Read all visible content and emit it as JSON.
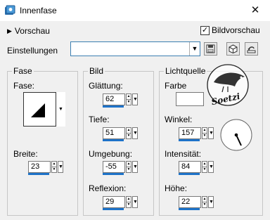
{
  "window": {
    "title": "Innenfase",
    "close_glyph": "✕"
  },
  "preview": {
    "toggle_label": "Vorschau",
    "bildvorschau_label": "Bildvorschau",
    "bildvorschau_checked": true
  },
  "settings": {
    "label": "Einstellungen",
    "value": ""
  },
  "fase_group": {
    "title": "Fase",
    "fase_label": "Fase:",
    "breite_label": "Breite:",
    "breite_value": "23"
  },
  "bild_group": {
    "title": "Bild",
    "glaettung_label": "Glättung:",
    "glaettung_value": "62",
    "tiefe_label": "Tiefe:",
    "tiefe_value": "51",
    "umgebung_label": "Umgebung:",
    "umgebung_value": "-55",
    "reflexion_label": "Reflexion:",
    "reflexion_value": "29"
  },
  "licht_group": {
    "title": "Lichtquelle",
    "farbe_label": "Farbe",
    "winkel_label": "Winkel:",
    "winkel_value": "157",
    "intensitaet_label": "Intensität:",
    "intensitaet_value": "84",
    "hoehe_label": "Höhe:",
    "hoehe_value": "22"
  },
  "watermark": {
    "text": "Soetzi"
  },
  "colors": {
    "accent": "#1e73c9",
    "title_bg": "#ffffff",
    "dialog_bg": "#f0f0f0",
    "light_color": "#ffffff"
  },
  "icons": [
    "app-icon",
    "close-icon",
    "chevron-right-icon",
    "checkbox-check-icon",
    "save-icon",
    "dice-icon",
    "reset-icon",
    "angle-dial-icon"
  ]
}
